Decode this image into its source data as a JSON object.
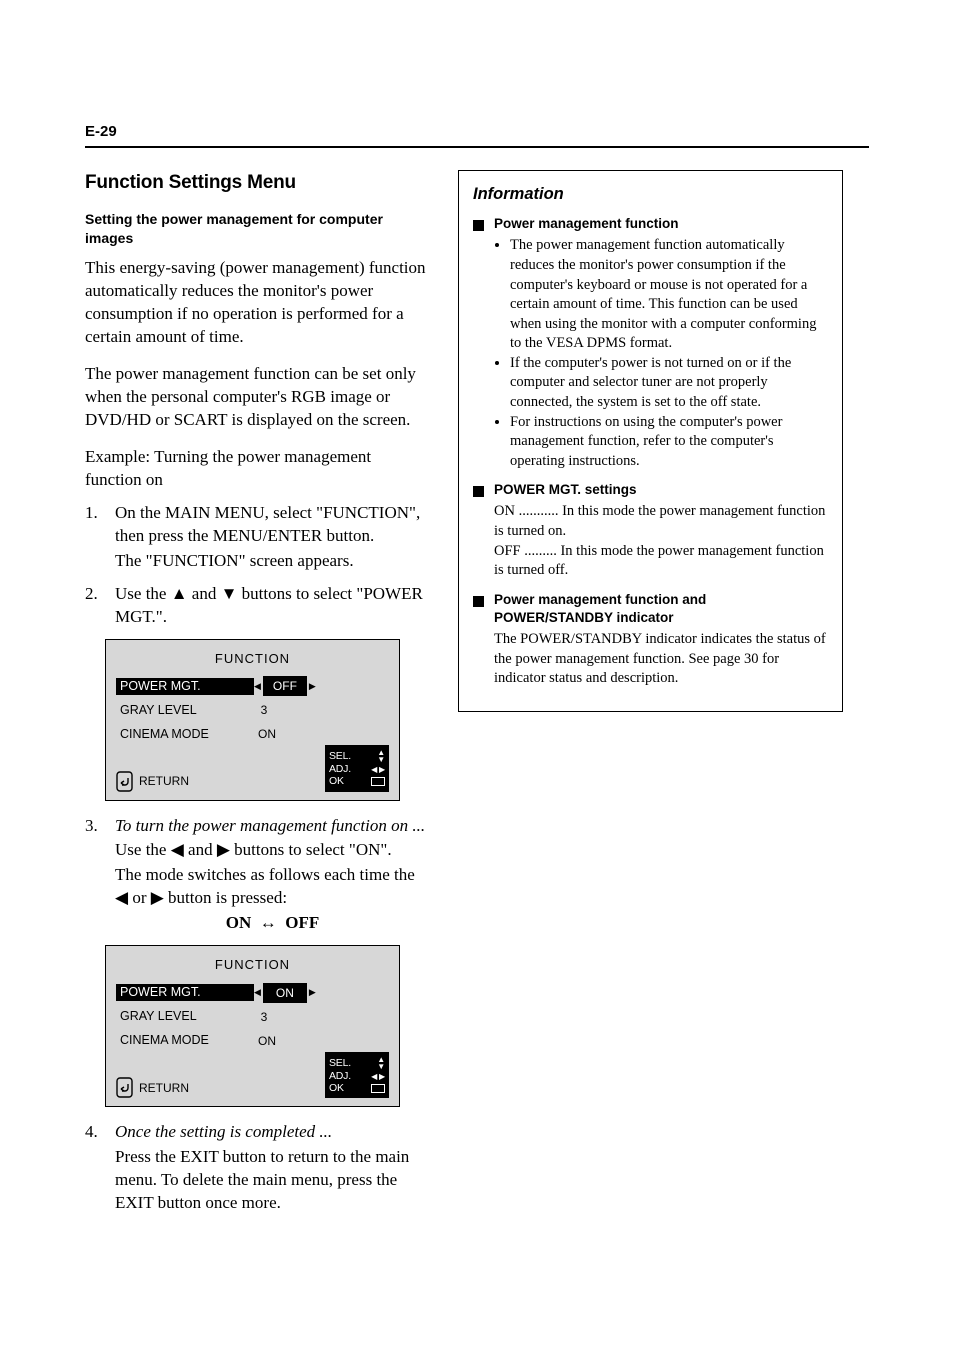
{
  "page_number": "E-29",
  "section_heading": "Function Settings Menu",
  "lede": "Setting the power management for computer images",
  "body_p1": "This energy-saving (power management) function automatically reduces the monitor's power consumption if no operation is performed for a certain amount of time.",
  "body_p2": "The power management function can be set only when the personal computer's RGB image or DVD/HD or SCART is displayed on the screen.",
  "example_label": "Example: Turning the power management function on",
  "step1": {
    "num": "1.",
    "l1": "On the MAIN MENU, select \"FUNCTION\", then press the MENU/ENTER button.",
    "l2": "The \"FUNCTION\" screen appears."
  },
  "step2": {
    "num": "2.",
    "line": "Use the ▲ and ▼ buttons to select \"POWER MGT.\"."
  },
  "osd_a": {
    "title": "FUNCTION",
    "rows": [
      {
        "label": "POWER MGT.",
        "value": "OFF",
        "selected": true
      },
      {
        "label": "GRAY LEVEL",
        "value": "3",
        "selected": false
      },
      {
        "label": "CINEMA MODE",
        "value": "ON",
        "selected": false
      }
    ],
    "return": "RETURN",
    "nav": {
      "sel": "SEL.",
      "adj": "ADJ.",
      "ok": "OK"
    }
  },
  "step3": {
    "num": "3.",
    "line": "To turn the power management function on ...",
    "sub": "Use the ◀ and ▶ buttons to select \"ON\".",
    "sub2": "The mode switches as follows each time the ◀ or ▶ button is pressed:",
    "toggle_a": "ON",
    "toggle_b": "OFF"
  },
  "osd_b": {
    "title": "FUNCTION",
    "rows": [
      {
        "label": "POWER MGT.",
        "value": "ON",
        "selected": true
      },
      {
        "label": "GRAY LEVEL",
        "value": "3",
        "selected": false
      },
      {
        "label": "CINEMA MODE",
        "value": "ON",
        "selected": false
      }
    ],
    "return": "RETURN",
    "nav": {
      "sel": "SEL.",
      "adj": "ADJ.",
      "ok": "OK"
    }
  },
  "step4": {
    "num": "4.",
    "line": "Once the setting is completed ...",
    "sub": "Press the EXIT button to return to the main menu. To delete the main menu, press the EXIT button once more."
  },
  "info": {
    "heading": "Information",
    "power_mgmt_title": "Power management function",
    "power_mgmt_points": [
      "The power management function automatically reduces the monitor's power consumption if the computer's keyboard or mouse is not operated for a certain amount of time. This function can be used when using the monitor with a computer conforming to the VESA DPMS format.",
      "If the computer's power is not turned on or if the computer and selector tuner are not properly connected, the system is set to the off state.",
      "For instructions on using the computer's power management function, refer to the computer's operating instructions."
    ],
    "pm_settings_title": "POWER MGT. settings",
    "pm_on": "ON ........... In this mode the power management function is turned on.",
    "pm_off": "OFF ......... In this mode the power management function is turned off.",
    "indicator_title": "Power management function and POWER/STANDBY indicator",
    "indicator_body": "The POWER/STANDBY indicator indicates the status of the power management function. See page 30 for indicator status and description."
  }
}
